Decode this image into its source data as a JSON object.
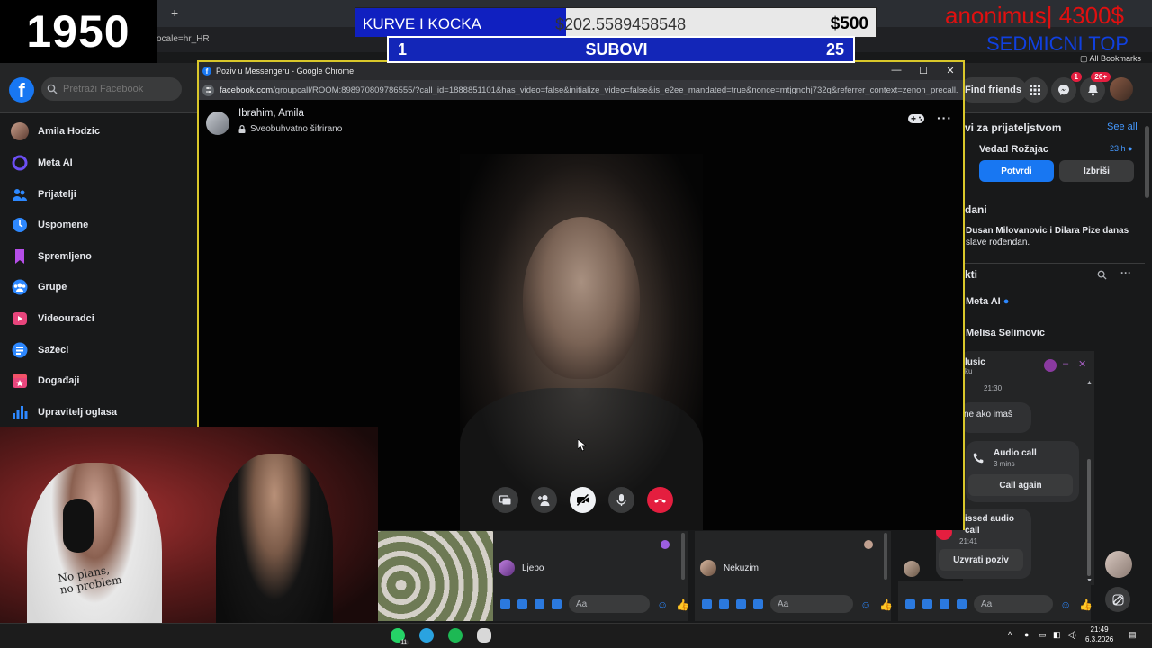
{
  "overlay": {
    "counter": "1950",
    "goal": {
      "name": "KURVE I KOCKA",
      "amount": "$202.5589458548",
      "target": "$500",
      "progress": 0.405
    },
    "subs": {
      "current": "1",
      "label": "SUBOVI",
      "goal": "25",
      "progress": 0.04
    },
    "donor_top": "anonimus| 4300$",
    "donor_sub": "SEDMICNI TOP"
  },
  "background_browser": {
    "partial_url": "ocale=hr_HR",
    "bookmarks_label": "All Bookmarks"
  },
  "facebook": {
    "search_placeholder": "Pretraži Facebook",
    "find_friends": "Find friends",
    "messenger_badge": "1",
    "notifications_badge": "20+",
    "sidebar": [
      {
        "label": "Amila Hodzic",
        "icon": "user-avatar"
      },
      {
        "label": "Meta AI",
        "icon": "meta-ai-icon"
      },
      {
        "label": "Prijatelji",
        "icon": "friends-icon"
      },
      {
        "label": "Uspomene",
        "icon": "clock-icon"
      },
      {
        "label": "Spremljeno",
        "icon": "bookmark-icon"
      },
      {
        "label": "Grupe",
        "icon": "groups-icon"
      },
      {
        "label": "Videouradci",
        "icon": "video-icon"
      },
      {
        "label": "Sažeci",
        "icon": "feeds-icon"
      },
      {
        "label": "Događaji",
        "icon": "calendar-icon"
      },
      {
        "label": "Upravitelj oglasa",
        "icon": "bar-chart-icon"
      }
    ],
    "right": {
      "friend_requests_title": "vi za prijateljstvom",
      "see_all": "See all",
      "request_name": "Vedad Rožajac",
      "request_time": "23 h",
      "confirm": "Potvrdi",
      "delete": "Izbriši",
      "birthdays_title": "dani",
      "birthday_text_1": "Dusan Milovanovic i Dilara Pize danas",
      "birthday_text_2": "slave rođendan.",
      "contacts_title": "kti",
      "contact_1": "Meta AI",
      "contact_2": "Melisa Selimovic"
    },
    "chat": {
      "title": "lusic",
      "subtitle": "ku",
      "time": "21:30",
      "message": "ne ako imaš",
      "audio_call": "Audio call",
      "audio_duration": "3 mins",
      "call_again": "Call again",
      "missed_1": "issed audio",
      "missed_2": "call",
      "missed_time": "21:41",
      "call_back": "Uzvrati poziv"
    },
    "chat_heads": [
      {
        "message": "Ljepo",
        "placeholder": "Aa"
      },
      {
        "message": "Nekuzim",
        "placeholder": "Aa"
      },
      {
        "placeholder": "Aa"
      }
    ]
  },
  "call_window": {
    "title": "Poziv u Messengeru - Google Chrome",
    "url_host": "facebook.com",
    "url_path": "/groupcall/ROOM:898970809786555/?call_id=1888851101&has_video=false&initialize_video=false&is_e2ee_mandated=true&nonce=mtjgnohj732q&referrer_context=zenon_precall...",
    "participant": "Ibrahim, Amila",
    "encryption": "Sveobuhvatno šifrirano"
  },
  "webcam": {
    "shirt_text_1": "No plans,",
    "shirt_text_2": "no problem"
  },
  "taskbar": {
    "time": "21:49",
    "date": "6.3.2026",
    "whatsapp_badge": "11"
  },
  "colors": {
    "fb_blue": "#1877f2",
    "accent_red": "#e41e3f",
    "call_border": "#d9c72a",
    "goal_blue": "#1020c0"
  }
}
